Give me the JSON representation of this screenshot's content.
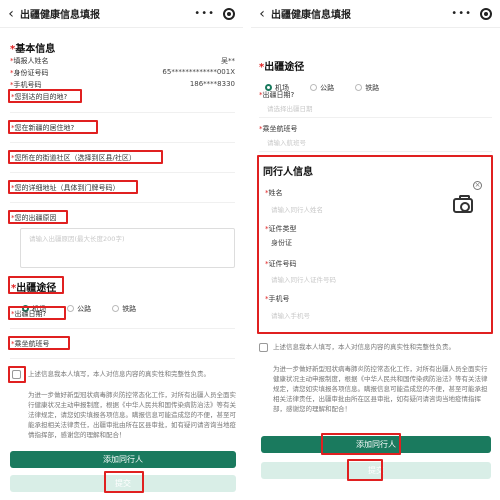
{
  "nav": {
    "back_glyph": "‹",
    "title": "出疆健康信息填报",
    "dots": "•••"
  },
  "left": {
    "basic_info": "基本信息",
    "fields": [
      {
        "label": "填报人姓名",
        "value": "吴**"
      },
      {
        "label": "身份证号码",
        "value": "65*************001X"
      },
      {
        "label": "手机号码",
        "value": "186****8330"
      }
    ],
    "destination_label": "您到达的目的地?",
    "residence_label": "您在新疆的居住地?",
    "street_label": "您所在的街道社区（选择到区县/社区）",
    "address_label": "您的详细地址（具体到门牌号码）",
    "reason_label": "您的出疆原因",
    "reason_placeholder": "请输入出疆原因(最大长度200字)",
    "route_section": "出疆途径",
    "route_options": [
      "机场",
      "公路",
      "铁路"
    ],
    "departure_date_label": "出疆日期?",
    "flight_label": "乘坐航班号",
    "consent_text": "上述信息我本人填写，本人对信息内容的真实性和完整性负责。",
    "notice_text": "为进一步做好新型冠状病毒肺炎防控常态化工作，对所有出疆人员全面实行健康状况主动申报制度，根据《中华人民共和国传染病防治法》等有关法律规定，请您如实填报各项信息。瞒报信息可能造成您的不便，甚至可能承担相关法律责任，出疆审批由所在区县审批，如有疑问请咨询当地疫情指挥部，感谢您的理解和配合！",
    "add_companion": "添加同行人",
    "submit": "提交"
  },
  "right": {
    "route_section": "出疆途径",
    "route_options": [
      "机场",
      "公路",
      "铁路"
    ],
    "departure_date_label": "出疆日期?",
    "departure_date_placeholder": "请选择出疆日期",
    "flight_label": "乘坐航班号",
    "flight_placeholder": "请输入航班号",
    "companion_title": "同行人信息",
    "name_label": "姓名",
    "name_placeholder": "请输入同行人姓名",
    "id_type_label": "证件类型",
    "id_type_value": "身份证",
    "id_number_label": "证件号码",
    "id_number_placeholder": "请输入同行人证件号码",
    "phone_label": "手机号",
    "phone_placeholder": "请输入手机号",
    "consent_text": "上述信息我本人填写，本人对信息内容的真实性和完整性负责。",
    "notice_text": "为进一步做好新型冠状病毒肺炎防控常态化工作，对所有出疆人员全面实行健康状况主动申报制度，根据《中华人民共和国传染病防治法》等有关法律规定，请您如实填报各项信息。瞒报信息可能造成您的不便，甚至可能承担相关法律责任，出疆审批由所在区县审批，如有疑问请咨询当地疫情指挥部，感谢您的理解和配合！",
    "add_companion": "添加同行人",
    "submit": "提交"
  },
  "colors": {
    "accent": "#1a7a5e",
    "highlight": "#e02020",
    "required": "#e02020"
  },
  "icons": [
    "back-arrow-icon",
    "more-dots-icon",
    "target-icon",
    "camera-icon",
    "close-icon"
  ]
}
